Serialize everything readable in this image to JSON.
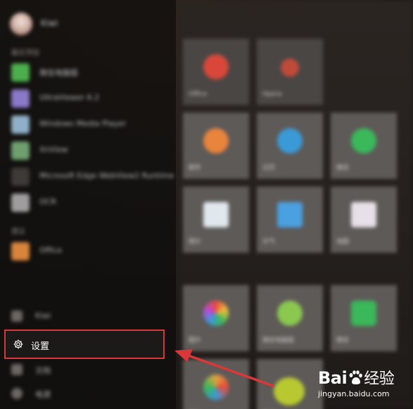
{
  "start_menu": {
    "user": {
      "name": "Kiwi"
    },
    "sections": [
      {
        "heading": "最近添加",
        "apps": [
          {
            "label": "微信电脑版",
            "icon": "green-app-icon",
            "color": "#4cae4c"
          },
          {
            "label": "UltraViewer 6.2",
            "icon": "purple-app-icon",
            "color": "#8a78c8"
          },
          {
            "label": "Windows Media Player",
            "icon": "media-app-icon",
            "color": "#8fb0c8"
          },
          {
            "label": "XnView",
            "icon": "photo-app-icon",
            "color": "#6f9f6f"
          },
          {
            "label": "Microsoft Edge WebView2 Runtime",
            "icon": "blank-app-icon",
            "color": "#3d3a37"
          },
          {
            "label": "OCR",
            "icon": "gray-app-icon",
            "color": "#9e9e9e"
          }
        ]
      },
      {
        "heading": "建议",
        "apps": [
          {
            "label": "Office",
            "icon": "orange-app-icon",
            "color": "#d8843c"
          }
        ]
      }
    ],
    "power_rows": [
      {
        "label": "Kiwi",
        "icon": "user-icon"
      },
      {
        "label": "文档",
        "icon": "document-icon"
      },
      {
        "label": "电源",
        "icon": "power-icon"
      }
    ],
    "settings": {
      "label": "设置",
      "icon": "gear-icon"
    },
    "tiles": [
      {
        "label": "Office",
        "color": "#d8473a"
      },
      {
        "label": "Opera",
        "color": "#c04a3a"
      },
      {
        "label": "邮件",
        "color": "#e8843c"
      },
      {
        "label": "日历",
        "color": "#3a9ad8"
      },
      {
        "label": "微信",
        "color": "#3ab85a"
      },
      {
        "label": "照片",
        "color": "#e0e8ee"
      },
      {
        "label": "天气",
        "color": "#4aa0e0"
      },
      {
        "label": "地图",
        "color": "#e8e0e8"
      },
      {
        "label": "图片",
        "color": "#d8a050"
      },
      {
        "label": "微信电脑版",
        "color": "#8ac850"
      },
      {
        "label": "微信",
        "color": "#3ab85a"
      },
      {
        "label": "照片",
        "color": "#e0a040"
      },
      {
        "label": "微信",
        "color": "#b8c830"
      }
    ]
  },
  "annotation": {
    "highlight_color": "#d9383a",
    "arrow_color": "#d9383a"
  },
  "watermark": {
    "brand": "Bai",
    "brand_cn": "经验",
    "url": "jingyan.baidu.com"
  }
}
